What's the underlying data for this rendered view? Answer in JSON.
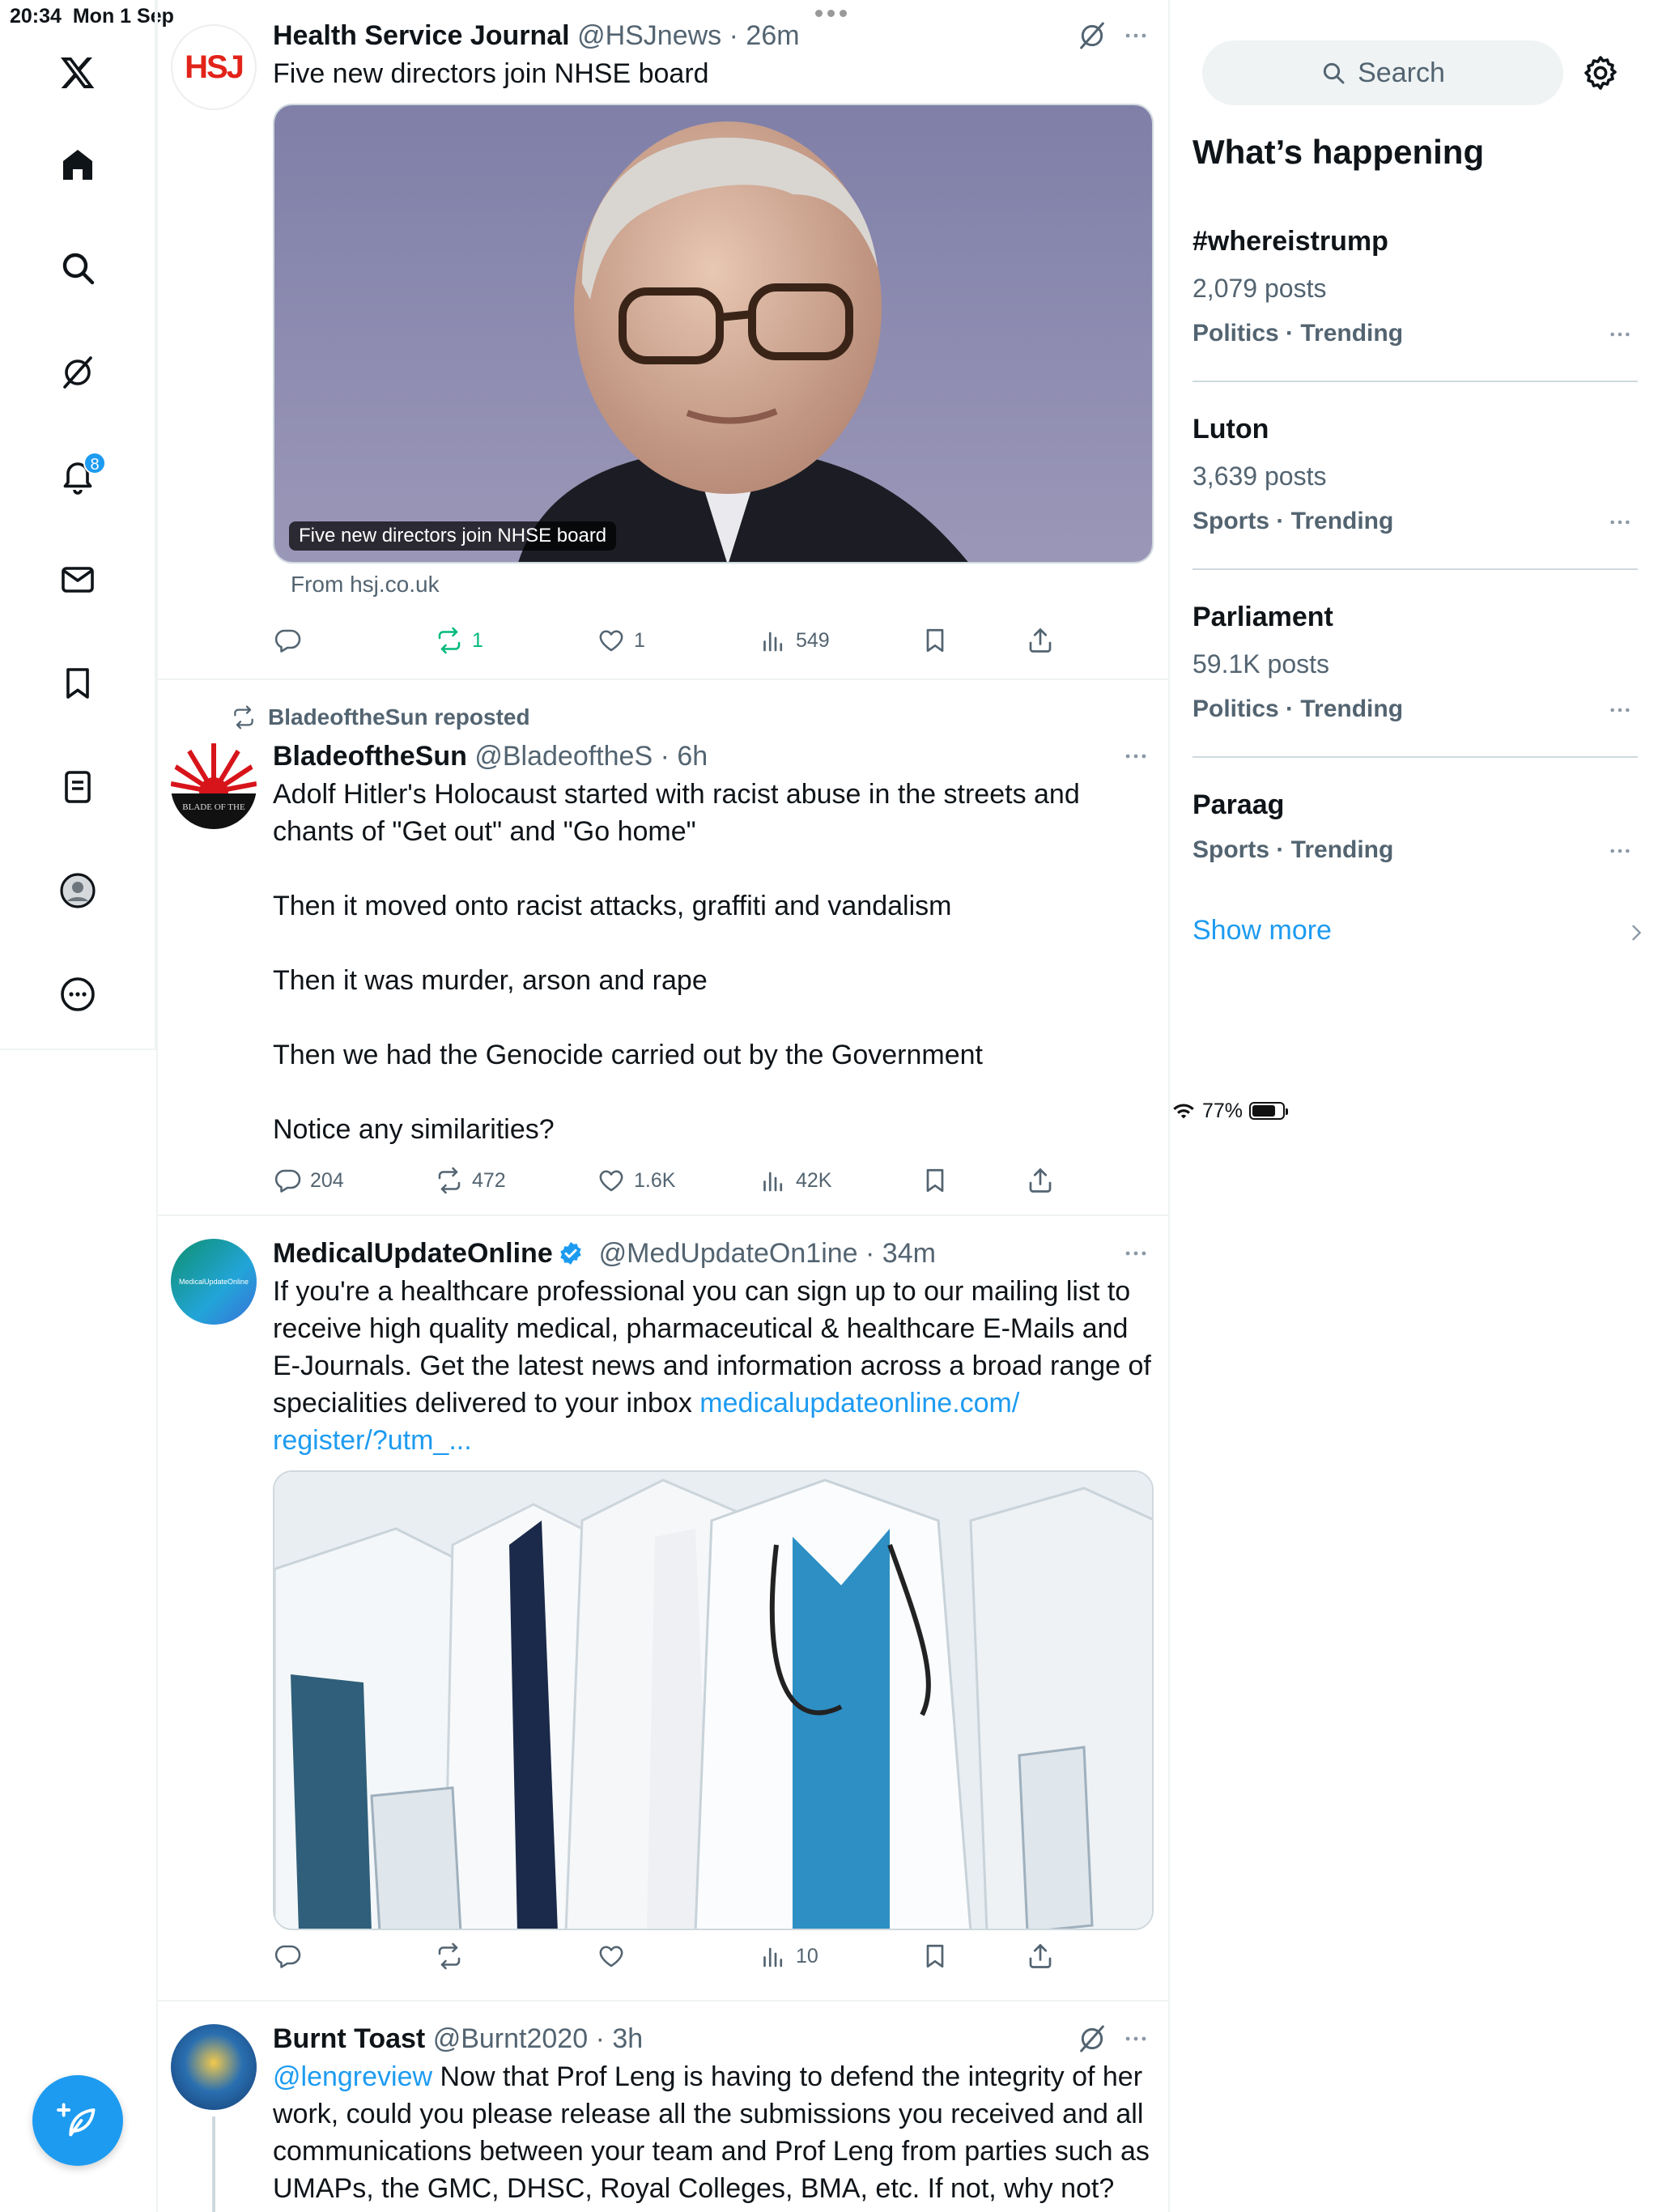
{
  "status_bar": {
    "time": "20:34",
    "date": "Mon 1 Sep",
    "battery": "77%",
    "battery_level": 0.77
  },
  "nav": {
    "notifications_badge": "8"
  },
  "tweets": [
    {
      "name": "Health Service Journal",
      "handle": "@HSJnews",
      "time": "26m",
      "text": "Five new directors join NHSE board",
      "media_caption": "Five new directors join NHSE board",
      "from": "From hsj.co.uk",
      "avatar_text": "HSJ",
      "replies": "",
      "reposts": "1",
      "likes": "1",
      "views": "549"
    },
    {
      "repost_by": "BladeoftheSun reposted",
      "name": "BladeoftheSun",
      "handle": "@BladeoftheS",
      "time": "6h",
      "text": "Adolf Hitler's Holocaust started with racist abuse in the streets and chants of \"Get out\" and \"Go home\"\n\nThen it moved onto racist attacks, graffiti and vandalism\n\nThen it was murder, arson and rape\n\nThen we had the Genocide carried out by the Government\n\nNotice any similarities?",
      "avatar_text": "BLADE OF THE",
      "replies": "204",
      "reposts": "472",
      "likes": "1.6K",
      "views": "42K"
    },
    {
      "name": "MedicalUpdateOnline",
      "handle": "@MedUpdateOn1ine",
      "time": "34m",
      "text": "If you're a healthcare professional you can sign up to our mailing list to receive high quality medical, pharmaceutical & healthcare E-Mails and E-Journals. Get the latest news and information across a broad range of specialities delivered to your inbox ",
      "link": "medicalupdateonline.com/\nregister/?utm_...",
      "avatar_text": "MedicalUpdateOnline",
      "replies": "",
      "reposts": "",
      "likes": "",
      "views": "10"
    },
    {
      "name": "Burnt Toast",
      "handle": "@Burnt2020",
      "time": "3h",
      "mention": "@lengreview",
      "text": " Now that Prof Leng is having to defend the integrity of her work, could you please release all the submissions you received and all communications between your team and Prof Leng from parties such as UMAPs, the GMC, DHSC, Royal Colleges, BMA, etc. If not, why not?"
    }
  ],
  "sidebar": {
    "search_placeholder": "Search",
    "whats_happening": "What’s happening",
    "trends": [
      {
        "title": "#whereistrump",
        "count": "2,079 posts",
        "meta": "Politics · Trending"
      },
      {
        "title": "Luton",
        "count": "3,639 posts",
        "meta": "Sports · Trending"
      },
      {
        "title": "Parliament",
        "count": "59.1K posts",
        "meta": "Politics · Trending"
      },
      {
        "title": "Paraag",
        "count": "",
        "meta": "Sports · Trending"
      }
    ],
    "show_more": "Show more"
  },
  "colors": {
    "accent": "#1d9bf0",
    "repost_active": "#00ba7c",
    "secondary_text": "#536471"
  },
  "icons": [
    "x-logo-icon",
    "home-icon",
    "search-icon",
    "grok-icon",
    "bell-icon",
    "mail-icon",
    "bookmark-icon",
    "lists-icon",
    "profile-icon",
    "more-circle-icon",
    "compose-icon",
    "reply-icon",
    "repost-icon",
    "like-icon",
    "views-icon",
    "share-icon",
    "gear-icon",
    "verified-icon"
  ]
}
